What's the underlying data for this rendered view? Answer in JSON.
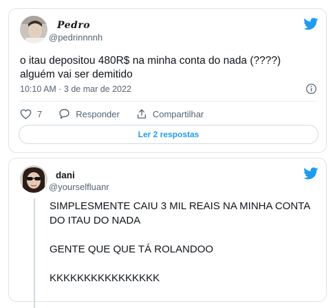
{
  "tweet1": {
    "display_name": "Pedro",
    "handle": "@pedrinnnnh",
    "text_line1": "o itau depositou 480R$ na minha conta do nada (????)",
    "text_line2": "alguém vai ser demitido",
    "timestamp": "10:10 AM · 3 de mar de 2022",
    "like_count": "7",
    "reply_label": "Responder",
    "share_label": "Compartilhar",
    "read_replies_label": "Ler 2 respostas"
  },
  "tweet2": {
    "display_name": "dani",
    "handle": "@yourselfluanr",
    "paragraphs": [
      "SIMPLESMENTE CAIU 3 MIL REAIS NA MINHA CONTA DO ITAU DO NADA",
      "GENTE QUE QUE TÁ ROLANDOO",
      "KKKKKKKKKKKKKKKK"
    ]
  },
  "colors": {
    "twitter_blue": "#1d9bf0",
    "secondary_text": "#536471",
    "border": "#dfe3e6"
  },
  "icons": {
    "brand": "twitter-bird-icon",
    "like": "heart-icon",
    "reply": "speech-bubble-icon",
    "share": "share-upload-icon",
    "info": "info-icon"
  }
}
